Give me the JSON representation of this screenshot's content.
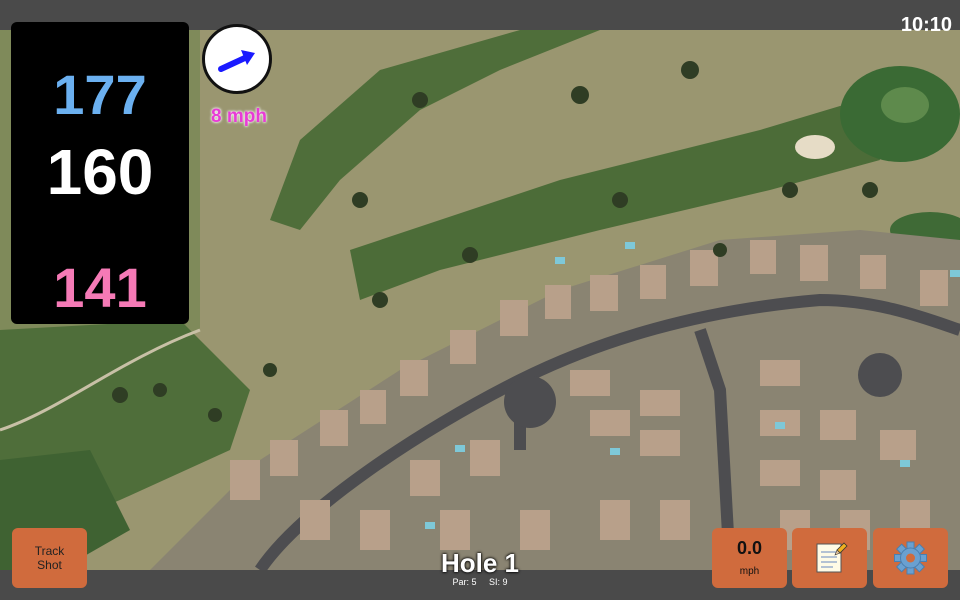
{
  "status": {
    "time": "10:10"
  },
  "distances": {
    "back": "177",
    "middle": "160",
    "front": "141"
  },
  "wind": {
    "speed_label": "8 mph",
    "arrow_icon": "wind-direction-arrow-icon"
  },
  "buttons": {
    "track_shot_line1": "Track",
    "track_shot_line2": "Shot",
    "wind_value": "0.0",
    "wind_unit": "mph",
    "notes_icon": "notepad-icon",
    "settings_icon": "gear-icon"
  },
  "hole": {
    "title": "Hole 1",
    "par": "Par: 5",
    "si": "SI: 9"
  },
  "colors": {
    "back": "#6bb0f0",
    "middle": "#ffffff",
    "front": "#f57ab6",
    "wind_text": "#e83bd6",
    "button": "#d06b3d",
    "chrome": "#4a4a4a"
  }
}
